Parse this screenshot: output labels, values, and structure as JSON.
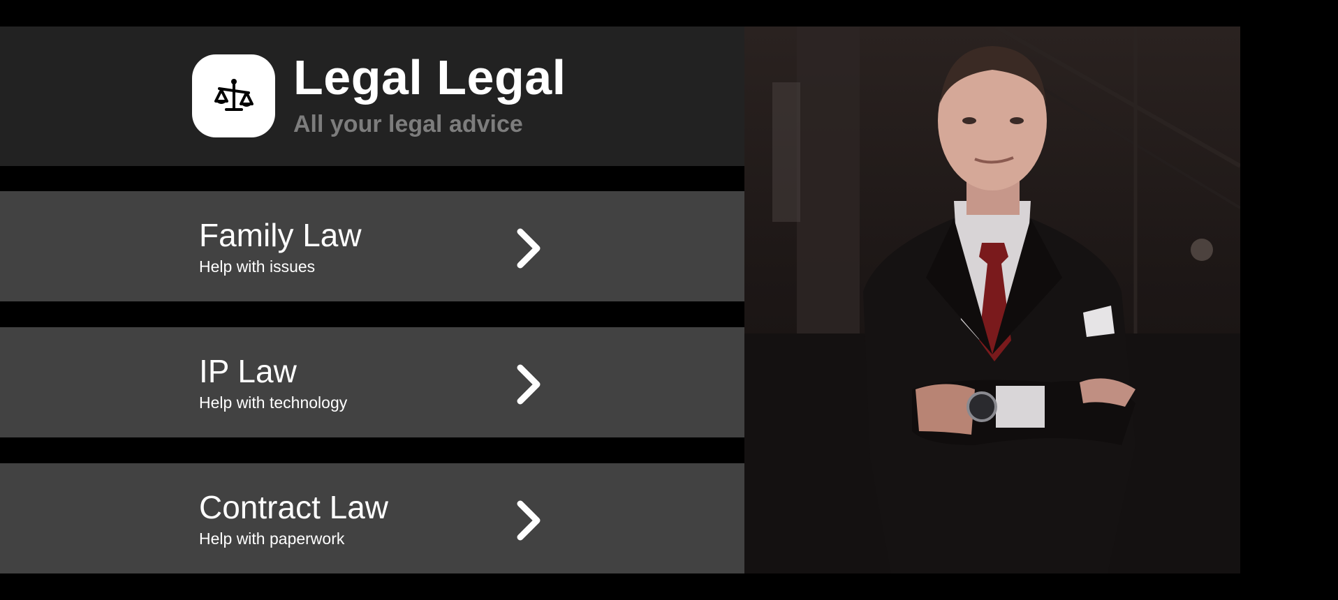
{
  "brand": {
    "title": "Legal Legal",
    "subtitle": "All your legal advice",
    "logo_icon": "scales-of-justice-icon"
  },
  "services": [
    {
      "title": "Family Law",
      "subtitle": "Help with issues",
      "icon": "chevron-right-icon"
    },
    {
      "title": "IP Law",
      "subtitle": "Help with technology",
      "icon": "chevron-right-icon"
    },
    {
      "title": "Contract Law",
      "subtitle": "Help with paperwork",
      "icon": "chevron-right-icon"
    }
  ],
  "photo": {
    "subject": "man in dark suit with red tie, arms crossed"
  },
  "colors": {
    "background": "#000000",
    "header": "#222222",
    "card": "#424242",
    "subtitle_gray": "#7d7d7d",
    "text": "#ffffff",
    "tie": "#7a1a1c"
  }
}
